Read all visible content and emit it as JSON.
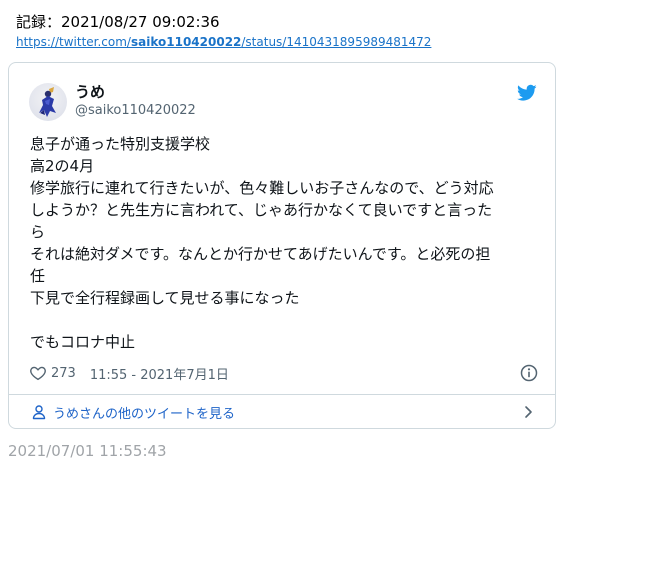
{
  "record": {
    "label": "記録：2021/08/27 09:02:36"
  },
  "source_link": {
    "prefix": "https://twitter.com/",
    "user": "saiko110420022",
    "suffix": "/status/1410431895989481472"
  },
  "tweet": {
    "name": "うめ",
    "handle": "@saiko110420022",
    "lines": [
      "息子が通った特別支援学校",
      "高2の4月",
      "修学旅行に連れて行きたいが、色々難しいお子さんなので、どう対応",
      "しようか？と先生方に言われて、じゃあ行かなくて良いですと言った",
      "ら",
      "それは絶対ダメです。なんとか行かせてあげたいんです。と必死の担",
      "任",
      "下見で全行程録画して見せる事になった",
      "",
      "でもコロナ中止"
    ],
    "likes": "273",
    "time": "11:55 - 2021年7月1日",
    "more_label": "うめさんの他のツイートを見る"
  },
  "archive_timestamp": "2021/07/01 11:55:43",
  "colors": {
    "twitter_blue": "#1d9bf0",
    "link_blue": "#1a73c8",
    "muted_gray": "#536471",
    "border": "#cfd9de"
  },
  "icons": {
    "bird": "twitter-bird-icon",
    "heart": "heart-icon",
    "info": "info-icon",
    "person": "person-icon",
    "chevron": "chevron-right-icon"
  }
}
